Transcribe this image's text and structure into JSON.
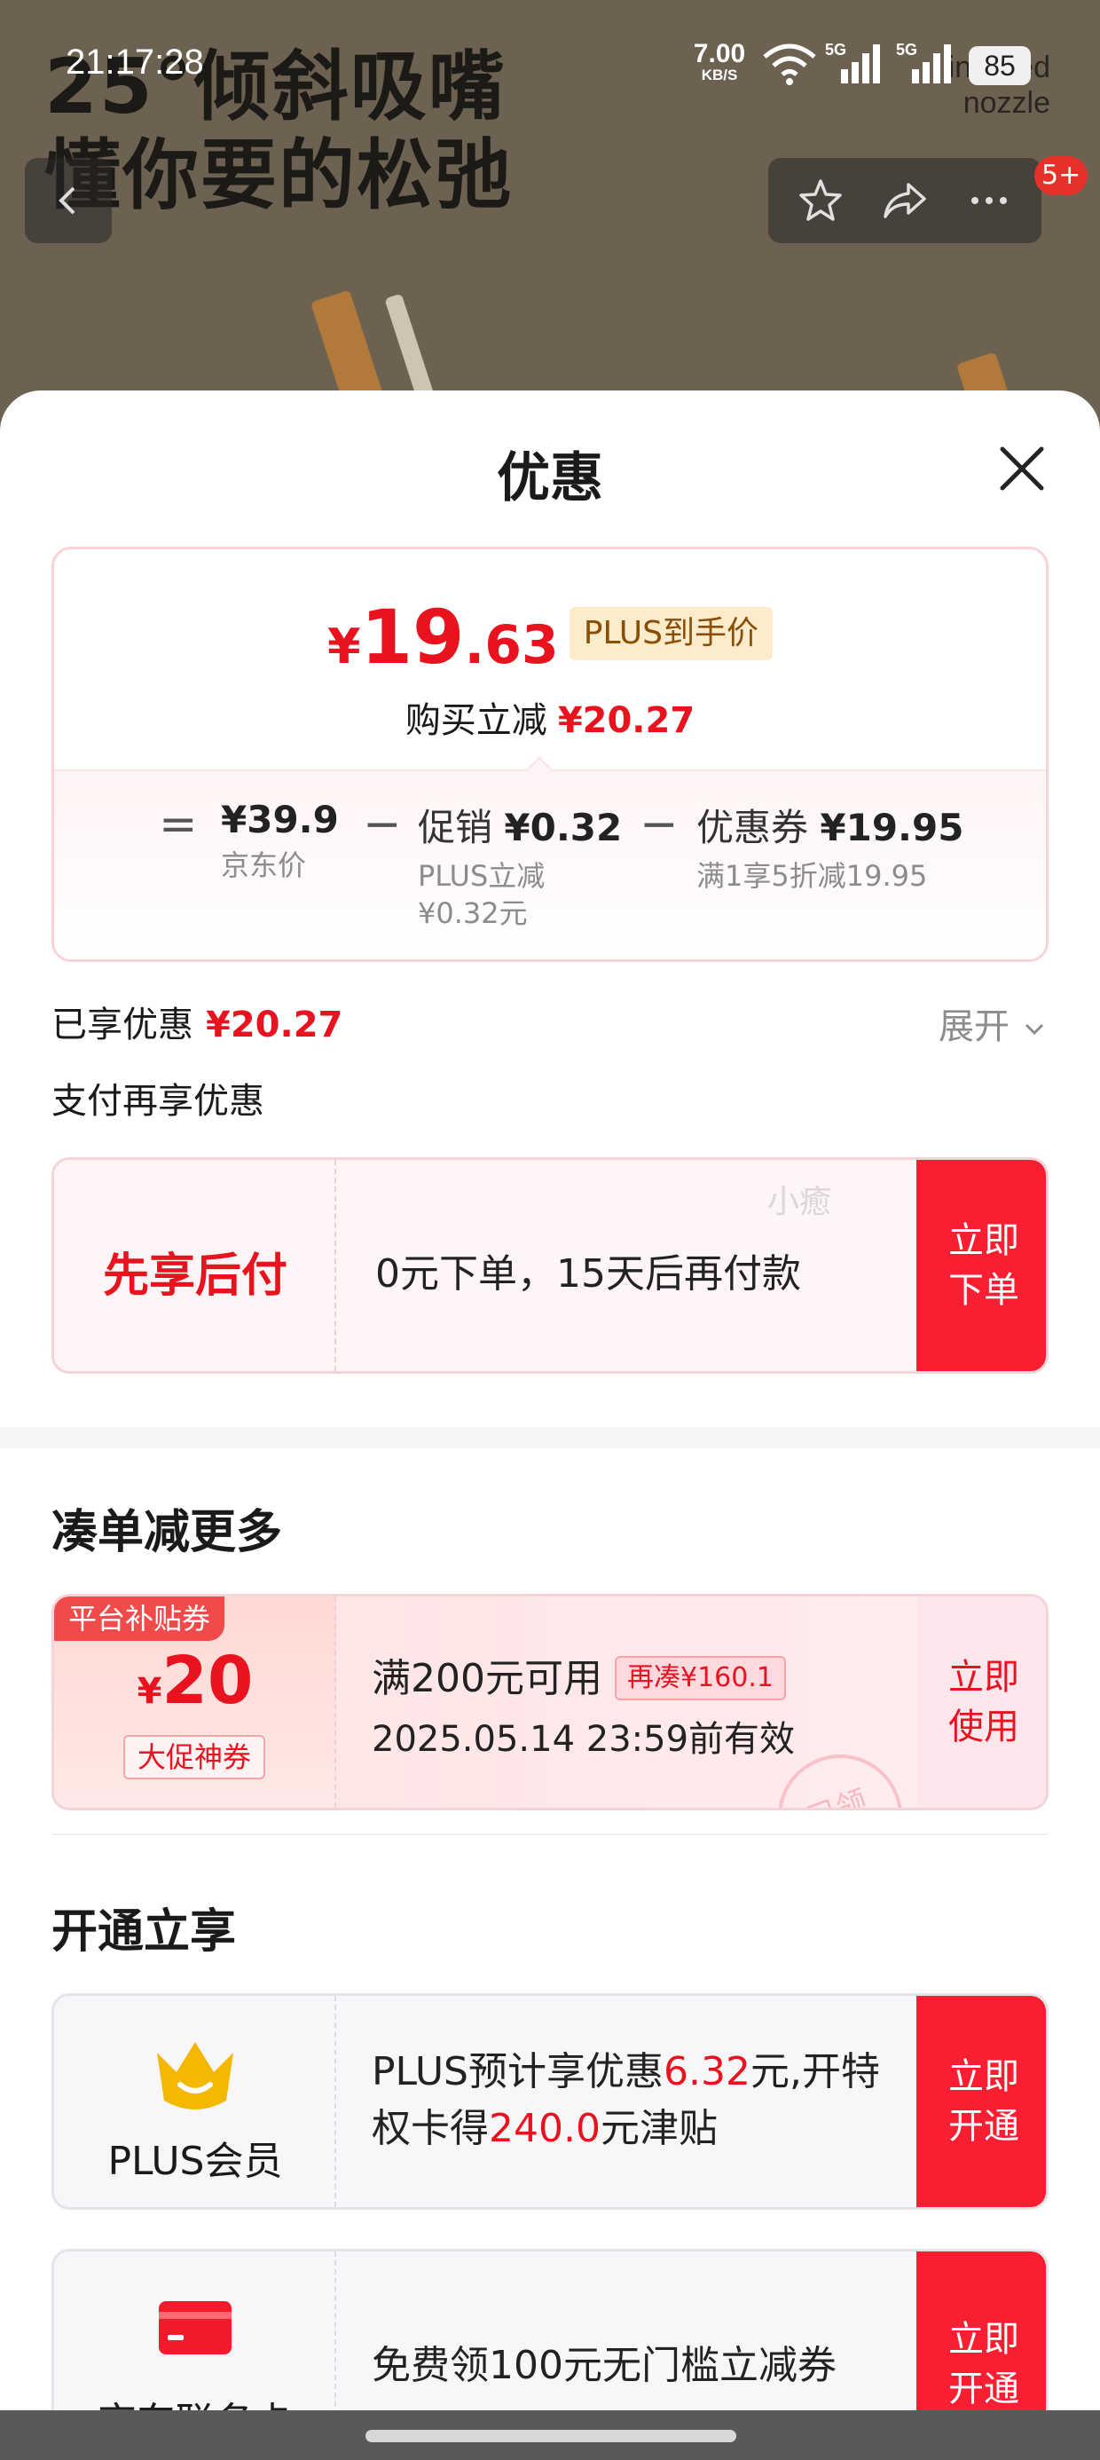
{
  "status_bar": {
    "time": "21:17:28",
    "net_speed_value": "7.00",
    "net_speed_unit": "KB/S",
    "signal_1": "5G",
    "signal_2": "5G",
    "battery": "85"
  },
  "background": {
    "headline_line1": "25°倾斜吸嘴",
    "headline_line2": "懂你要的松弛",
    "brand_line1": "inclined",
    "brand_line2": "nozzle",
    "cart_badge": "5+"
  },
  "sheet": {
    "title": "优惠"
  },
  "price_card": {
    "currency": "¥",
    "price_int": "19",
    "price_dec": ".63",
    "plus_tag": "PLUS到手价",
    "buy_reduce_label": "购买立减",
    "buy_reduce_amount": "¥20.27",
    "equals": "=",
    "minus": "−",
    "jd_price": "¥39.9",
    "jd_price_label": "京东价",
    "promo_label": "促销",
    "promo_amount": "¥0.32",
    "promo_note_line1": "PLUS立减",
    "promo_note_line2": "¥0.32元",
    "coupon_label": "优惠券",
    "coupon_amount": "¥19.95",
    "coupon_note": "满1享5折减19.95"
  },
  "enjoyed": {
    "label": "已享优惠",
    "amount": "¥20.27",
    "expand": "展开"
  },
  "pay_more": {
    "title": "支付再享优惠"
  },
  "bnpl": {
    "title": "先享后付",
    "desc": "0元下单，15天后再付款",
    "watermark": "小癒",
    "button": "立即下单"
  },
  "bundle": {
    "title": "凑单减更多",
    "tag": "平台补贴券",
    "currency": "¥",
    "amount": "20",
    "type": "大促神券",
    "condition": "满200元可用",
    "add_more": "再凑¥160.1",
    "valid": "2025.05.14 23:59前有效",
    "stamp": "已领",
    "button": "立即使用"
  },
  "open": {
    "title": "开通立享",
    "plus_name": "PLUS会员",
    "plus_desc_1": "PLUS预计享优惠",
    "plus_desc_amt1": "6.32",
    "plus_desc_2": "元,开特权卡得",
    "plus_desc_amt2": "240.0",
    "plus_desc_3": "元津贴",
    "plus_button": "立即开通",
    "jd_name": "京东联名卡",
    "jd_desc": "免费领100元无门槛立减券",
    "jd_button": "立即开通"
  },
  "colors": {
    "accent_red": "#fa1e32",
    "price_red": "#e8131f",
    "plus_gold": "#f5b800"
  }
}
